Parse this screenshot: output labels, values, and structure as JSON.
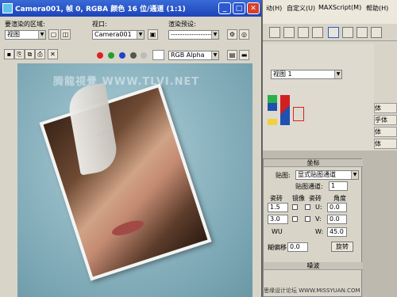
{
  "render_window": {
    "title": "Camera001, 帧 0, RGBA 颜色 16 位/通道 (1:1)",
    "area_label": "要渲染的区域:",
    "area_value": "视图",
    "viewport_label": "视口:",
    "viewport_value": "Camera001",
    "preset_label": "渲染预设:",
    "preset_value": "-------------------",
    "channel_value": "RGB Alpha",
    "watermark": "腾龍視覺 WWW.TLVI.NET"
  },
  "main_ui": {
    "menus": [
      "动(H)",
      "自定义(U)",
      "MAXScript(M)",
      "帮助(H)"
    ],
    "viewport_combo": "视图 1",
    "panel": {
      "header": "坐标",
      "map_label": "贴图:",
      "map_value": "显式贴图通道",
      "channel_label": "贴图通道:",
      "channel_value": "1",
      "col_headers": [
        "瓷砖",
        "镜像",
        "瓷砖",
        "角度"
      ],
      "u_tile": "1.5",
      "v_tile": "3.0",
      "u_label": "U:",
      "v_label": "V:",
      "w_label": "W:",
      "u_angle": "0.0",
      "v_angle": "0.0",
      "w_angle": "45.0",
      "wu_label": "WU",
      "blur_label": "糊偏移:",
      "blur_value": "0.0",
      "rotate_label": "旋转",
      "noise_header": "噪波"
    },
    "side_labels": [
      "体",
      "乎体",
      "体",
      "体"
    ],
    "bottom_watermark": "思缘设计论坛 WWW.MISSYUAN.COM"
  }
}
